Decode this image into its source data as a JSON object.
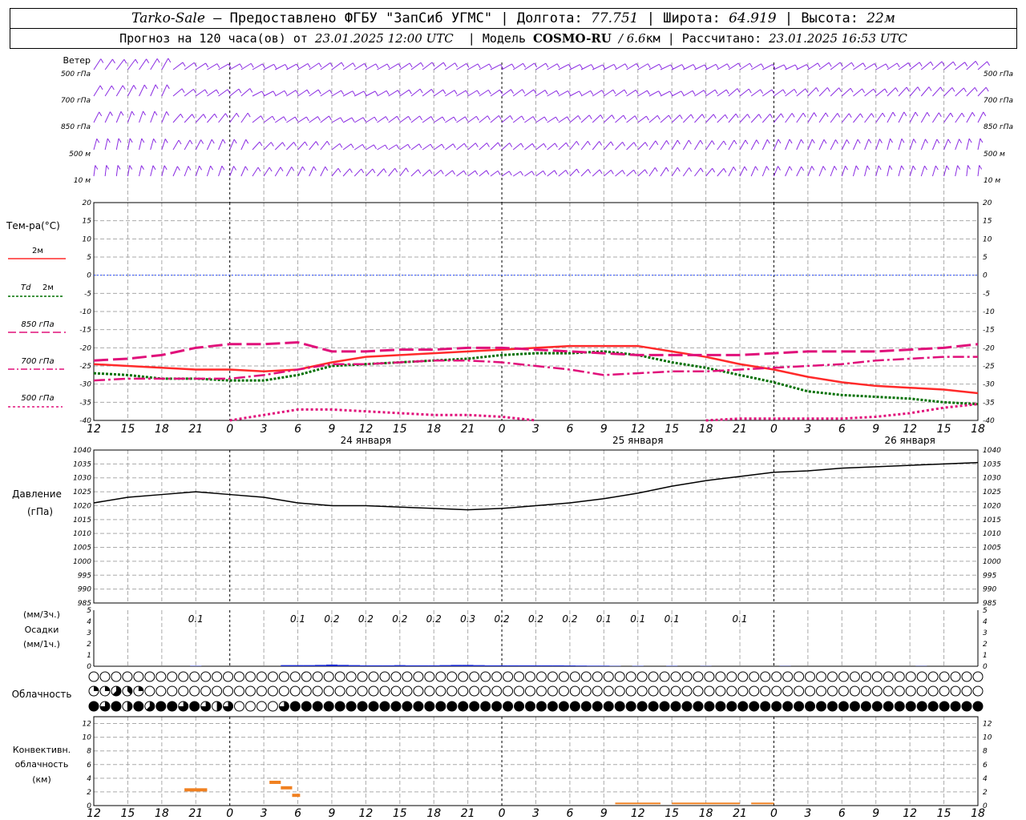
{
  "header": {
    "station": "Tarko-Sale",
    "provider": "– Предоставлено ФГБУ \"ЗапСиб УГМС\" |",
    "lon_label": "Долгота:",
    "lon": "77.751",
    "lat_label": "| Широта:",
    "lat": "64.919",
    "alt_label": "| Высота:",
    "alt": "22м",
    "fc_label": "Прогноз на 120 часа(ов) от",
    "fc_time": "23.01.2025 12:00 UTC",
    "model_label": "| Модель",
    "model": "COSMO-RU",
    "res": "/ 6.6",
    "res_unit": "км",
    "calc_label": "| Рассчитано:",
    "calc_time": "23.01.2025 16:53 UTC"
  },
  "labels": {
    "wind": "Ветер",
    "levels": [
      "500 гПа",
      "700 гПа",
      "850 гПа",
      "500 м",
      "10 м"
    ],
    "temp_title": "Тем-ра(°C)",
    "t2m": "2м",
    "td_prefix": "Td",
    "td_suffix": "2м",
    "t850": "850 гПа",
    "t700": "700 гПа",
    "t500": "500 гПа",
    "pressure": "Давление",
    "pressure_unit": "(гПа)",
    "precip_3h": "(мм/3ч.)",
    "precip": "Осадки",
    "precip_1h": "(мм/1ч.)",
    "cloud": "Облачность",
    "conv1": "Конвективн.",
    "conv2": "облачность",
    "conv3": "(км)",
    "days": [
      "24 января",
      "25 января",
      "26 января"
    ]
  },
  "colors": {
    "t2m": "#ff2a2a",
    "td": "#007000",
    "t850": "#e0107a",
    "t700": "#e0107a",
    "t500": "#e0107a",
    "pressure": "#000000",
    "precip": "#1a2ad0",
    "conv": "#f08020",
    "wind": "#8a2be2"
  },
  "chart_data": {
    "time_axis": {
      "hour_ticks": [
        "12",
        "15",
        "18",
        "21",
        "0",
        "3",
        "6",
        "9",
        "12",
        "15",
        "18",
        "21",
        "0",
        "3",
        "6",
        "9",
        "12",
        "15",
        "18",
        "21",
        "0",
        "3",
        "6",
        "9",
        "12",
        "15",
        "18"
      ],
      "start": "23.01.2025 12:00 UTC",
      "end": "26.01.2025 18:00 UTC"
    },
    "temperature": {
      "type": "line",
      "ylim": [
        -40,
        20
      ],
      "yticks": [
        20,
        15,
        10,
        5,
        0,
        -5,
        -10,
        -15,
        -20,
        -25,
        -30,
        -35,
        -40
      ],
      "x_hours": [
        0,
        3,
        6,
        9,
        12,
        15,
        18,
        21,
        24,
        27,
        30,
        33,
        36,
        39,
        42,
        45,
        48,
        51,
        54,
        57,
        60,
        63,
        66,
        69,
        72,
        75,
        78
      ],
      "series": [
        {
          "name": "2м",
          "values": [
            -24.5,
            -25,
            -25.5,
            -26,
            -26,
            -26.5,
            -26,
            -24,
            -22.5,
            -22,
            -21.5,
            -21,
            -20.5,
            -20,
            -19.5,
            -19.5,
            -19.5,
            -21,
            -22.5,
            -24.5,
            -26,
            -28,
            -29.5,
            -30.5,
            -31,
            -31.5,
            -32.5
          ]
        },
        {
          "name": "Td 2м",
          "values": [
            -27,
            -27.5,
            -28.5,
            -28.5,
            -29,
            -29,
            -27.5,
            -25,
            -24.5,
            -24,
            -23.5,
            -23,
            -22,
            -21.5,
            -21.5,
            -21,
            -22,
            -24,
            -25.5,
            -27.5,
            -29.5,
            -32,
            -33,
            -33.5,
            -34,
            -35,
            -35.5
          ]
        },
        {
          "name": "850 гПа",
          "values": [
            -23.5,
            -23,
            -22,
            -20,
            -19,
            -19,
            -18.5,
            -21,
            -21,
            -20.5,
            -20.5,
            -20,
            -20,
            -20.5,
            -21,
            -21.5,
            -22,
            -22,
            -22,
            -22,
            -21.5,
            -21,
            -21,
            -21,
            -20.5,
            -20,
            -19
          ]
        },
        {
          "name": "700 гПа",
          "values": [
            -29,
            -28.5,
            -28.5,
            -28.5,
            -28.5,
            -27.5,
            -26,
            -24.5,
            -24.5,
            -24,
            -23.5,
            -23.5,
            -24,
            -25,
            -26,
            -27.5,
            -27,
            -26.5,
            -26.5,
            -26,
            -25.5,
            -25,
            -24.5,
            -23.5,
            -23,
            -22.5,
            -22.5
          ]
        },
        {
          "name": "500 гПа",
          "values": [
            null,
            null,
            null,
            null,
            -40,
            -38.5,
            -37,
            -37,
            -37.5,
            -38,
            -38.5,
            -38.5,
            -39,
            -40,
            null,
            null,
            null,
            null,
            -40,
            -39.5,
            -39.5,
            -39.5,
            -39.5,
            -39,
            -38,
            -36.5,
            -35.5
          ]
        }
      ]
    },
    "pressure": {
      "type": "line",
      "ylim": [
        985,
        1040
      ],
      "yticks": [
        1040,
        1035,
        1030,
        1025,
        1020,
        1015,
        1010,
        1005,
        1000,
        995,
        990,
        985
      ],
      "x_hours": [
        0,
        3,
        6,
        9,
        12,
        15,
        18,
        21,
        24,
        27,
        30,
        33,
        36,
        39,
        42,
        45,
        48,
        51,
        54,
        57,
        60,
        63,
        66,
        69,
        72,
        75,
        78
      ],
      "values": [
        1021,
        1023,
        1024,
        1025,
        1024,
        1023,
        1021,
        1020,
        1020,
        1019.5,
        1019,
        1018.5,
        1019,
        1020,
        1021,
        1022.5,
        1024.5,
        1027,
        1029,
        1030.5,
        1032,
        1032.5,
        1033.5,
        1034,
        1034.5,
        1035,
        1035.5
      ]
    },
    "precipitation": {
      "type": "bar",
      "ylim": [
        0,
        5
      ],
      "yticks": [
        5,
        4,
        3,
        2,
        1,
        0
      ],
      "labels_3h": [
        {
          "h": 9,
          "v": "0.1"
        },
        {
          "h": 18,
          "v": "0.1"
        },
        {
          "h": 21,
          "v": "0.2"
        },
        {
          "h": 24,
          "v": "0.2"
        },
        {
          "h": 27,
          "v": "0.2"
        },
        {
          "h": 30,
          "v": "0.2"
        },
        {
          "h": 33,
          "v": "0.3"
        },
        {
          "h": 36,
          "v": "0.2"
        },
        {
          "h": 39,
          "v": "0.2"
        },
        {
          "h": 42,
          "v": "0.2"
        },
        {
          "h": 45,
          "v": "0.1"
        },
        {
          "h": 48,
          "v": "0.1"
        },
        {
          "h": 51,
          "v": "0.1"
        },
        {
          "h": 57,
          "v": "0.1"
        }
      ],
      "hourly_mm": [
        {
          "h": 9,
          "v": 0.03
        },
        {
          "h": 17,
          "v": 0.1
        },
        {
          "h": 18,
          "v": 0.1
        },
        {
          "h": 19,
          "v": 0.1
        },
        {
          "h": 20,
          "v": 0.12
        },
        {
          "h": 21,
          "v": 0.15
        },
        {
          "h": 22,
          "v": 0.12
        },
        {
          "h": 23,
          "v": 0.1
        },
        {
          "h": 24,
          "v": 0.08
        },
        {
          "h": 25,
          "v": 0.08
        },
        {
          "h": 26,
          "v": 0.08
        },
        {
          "h": 27,
          "v": 0.1
        },
        {
          "h": 28,
          "v": 0.08
        },
        {
          "h": 29,
          "v": 0.08
        },
        {
          "h": 30,
          "v": 0.08
        },
        {
          "h": 31,
          "v": 0.1
        },
        {
          "h": 32,
          "v": 0.12
        },
        {
          "h": 33,
          "v": 0.12
        },
        {
          "h": 34,
          "v": 0.1
        },
        {
          "h": 35,
          "v": 0.08
        },
        {
          "h": 36,
          "v": 0.08
        },
        {
          "h": 37,
          "v": 0.08
        },
        {
          "h": 38,
          "v": 0.08
        },
        {
          "h": 39,
          "v": 0.08
        },
        {
          "h": 40,
          "v": 0.08
        },
        {
          "h": 41,
          "v": 0.08
        },
        {
          "h": 42,
          "v": 0.07
        },
        {
          "h": 43,
          "v": 0.06
        },
        {
          "h": 44,
          "v": 0.05
        },
        {
          "h": 45,
          "v": 0.05
        },
        {
          "h": 46,
          "v": 0.03
        },
        {
          "h": 48,
          "v": 0.03
        },
        {
          "h": 51,
          "v": 0.03
        },
        {
          "h": 54,
          "v": 0.02
        },
        {
          "h": 61,
          "v": 0.02
        },
        {
          "h": 73,
          "v": 0.02
        }
      ]
    },
    "cloudiness": {
      "type": "symbols",
      "rows": [
        "upper",
        "middle",
        "lower"
      ],
      "octas": [
        [
          0,
          0,
          0,
          0,
          0,
          0,
          0,
          0,
          0,
          0,
          0,
          0,
          0,
          0,
          0,
          0,
          0,
          0,
          0,
          0,
          0,
          0,
          0,
          0,
          0,
          0,
          0,
          0,
          0,
          0,
          0,
          0,
          0,
          0,
          0,
          0,
          0,
          0,
          0,
          0,
          0,
          0,
          0,
          0,
          0,
          0,
          0,
          0,
          0,
          0,
          0,
          0,
          0,
          0,
          0,
          0,
          0,
          0,
          0,
          0,
          0,
          0,
          0,
          0,
          0,
          0,
          0,
          0,
          0,
          0,
          0,
          0,
          0,
          0,
          0,
          0,
          0,
          0,
          0,
          0
        ],
        [
          2,
          2,
          5,
          3,
          2,
          0,
          0,
          0,
          0,
          0,
          0,
          0,
          0,
          0,
          0,
          0,
          0,
          0,
          0,
          0,
          0,
          0,
          0,
          0,
          0,
          0,
          0,
          0,
          0,
          0,
          0,
          0,
          0,
          0,
          0,
          0,
          0,
          0,
          0,
          0,
          0,
          0,
          0,
          0,
          0,
          0,
          0,
          0,
          0,
          0,
          0,
          0,
          0,
          0,
          0,
          0,
          0,
          0,
          0,
          0,
          0,
          0,
          0,
          0,
          0,
          0,
          0,
          0,
          0,
          0,
          0,
          0,
          0,
          0,
          0,
          0,
          0,
          0,
          0,
          0
        ],
        [
          8,
          6,
          8,
          4,
          8,
          5,
          8,
          8,
          6,
          8,
          6,
          4,
          6,
          0,
          0,
          0,
          0,
          6,
          8,
          8,
          8,
          8,
          8,
          8,
          8,
          8,
          8,
          8,
          8,
          8,
          8,
          8,
          8,
          8,
          8,
          8,
          8,
          8,
          8,
          8,
          8,
          8,
          8,
          8,
          8,
          8,
          8,
          8,
          8,
          8,
          8,
          8,
          8,
          8,
          8,
          8,
          8,
          8,
          8,
          8,
          8,
          8,
          8,
          8,
          8,
          8,
          8,
          8,
          8,
          8,
          8,
          8,
          8,
          8,
          8,
          8,
          8,
          8,
          8,
          8
        ]
      ]
    },
    "convective_cloud": {
      "type": "bar",
      "ylim": [
        0,
        13
      ],
      "yticks": [
        12,
        10,
        8,
        6,
        4,
        2,
        0
      ],
      "segments": [
        {
          "from": 8,
          "to": 10,
          "km": 2.3
        },
        {
          "from": 15.5,
          "to": 16.5,
          "km": 3.4
        },
        {
          "from": 16.5,
          "to": 17.5,
          "km": 2.6
        },
        {
          "from": 17.5,
          "to": 18.2,
          "km": 1.5
        },
        {
          "from": 46,
          "to": 50,
          "km": 0.2
        },
        {
          "from": 51,
          "to": 57,
          "km": 0.2
        },
        {
          "from": 58,
          "to": 60,
          "km": 0.2
        }
      ]
    },
    "wind": {
      "type": "barbs",
      "levels": [
        "500 гПа",
        "700 гПа",
        "850 гПа",
        "500 м",
        "10 м"
      ]
    }
  }
}
